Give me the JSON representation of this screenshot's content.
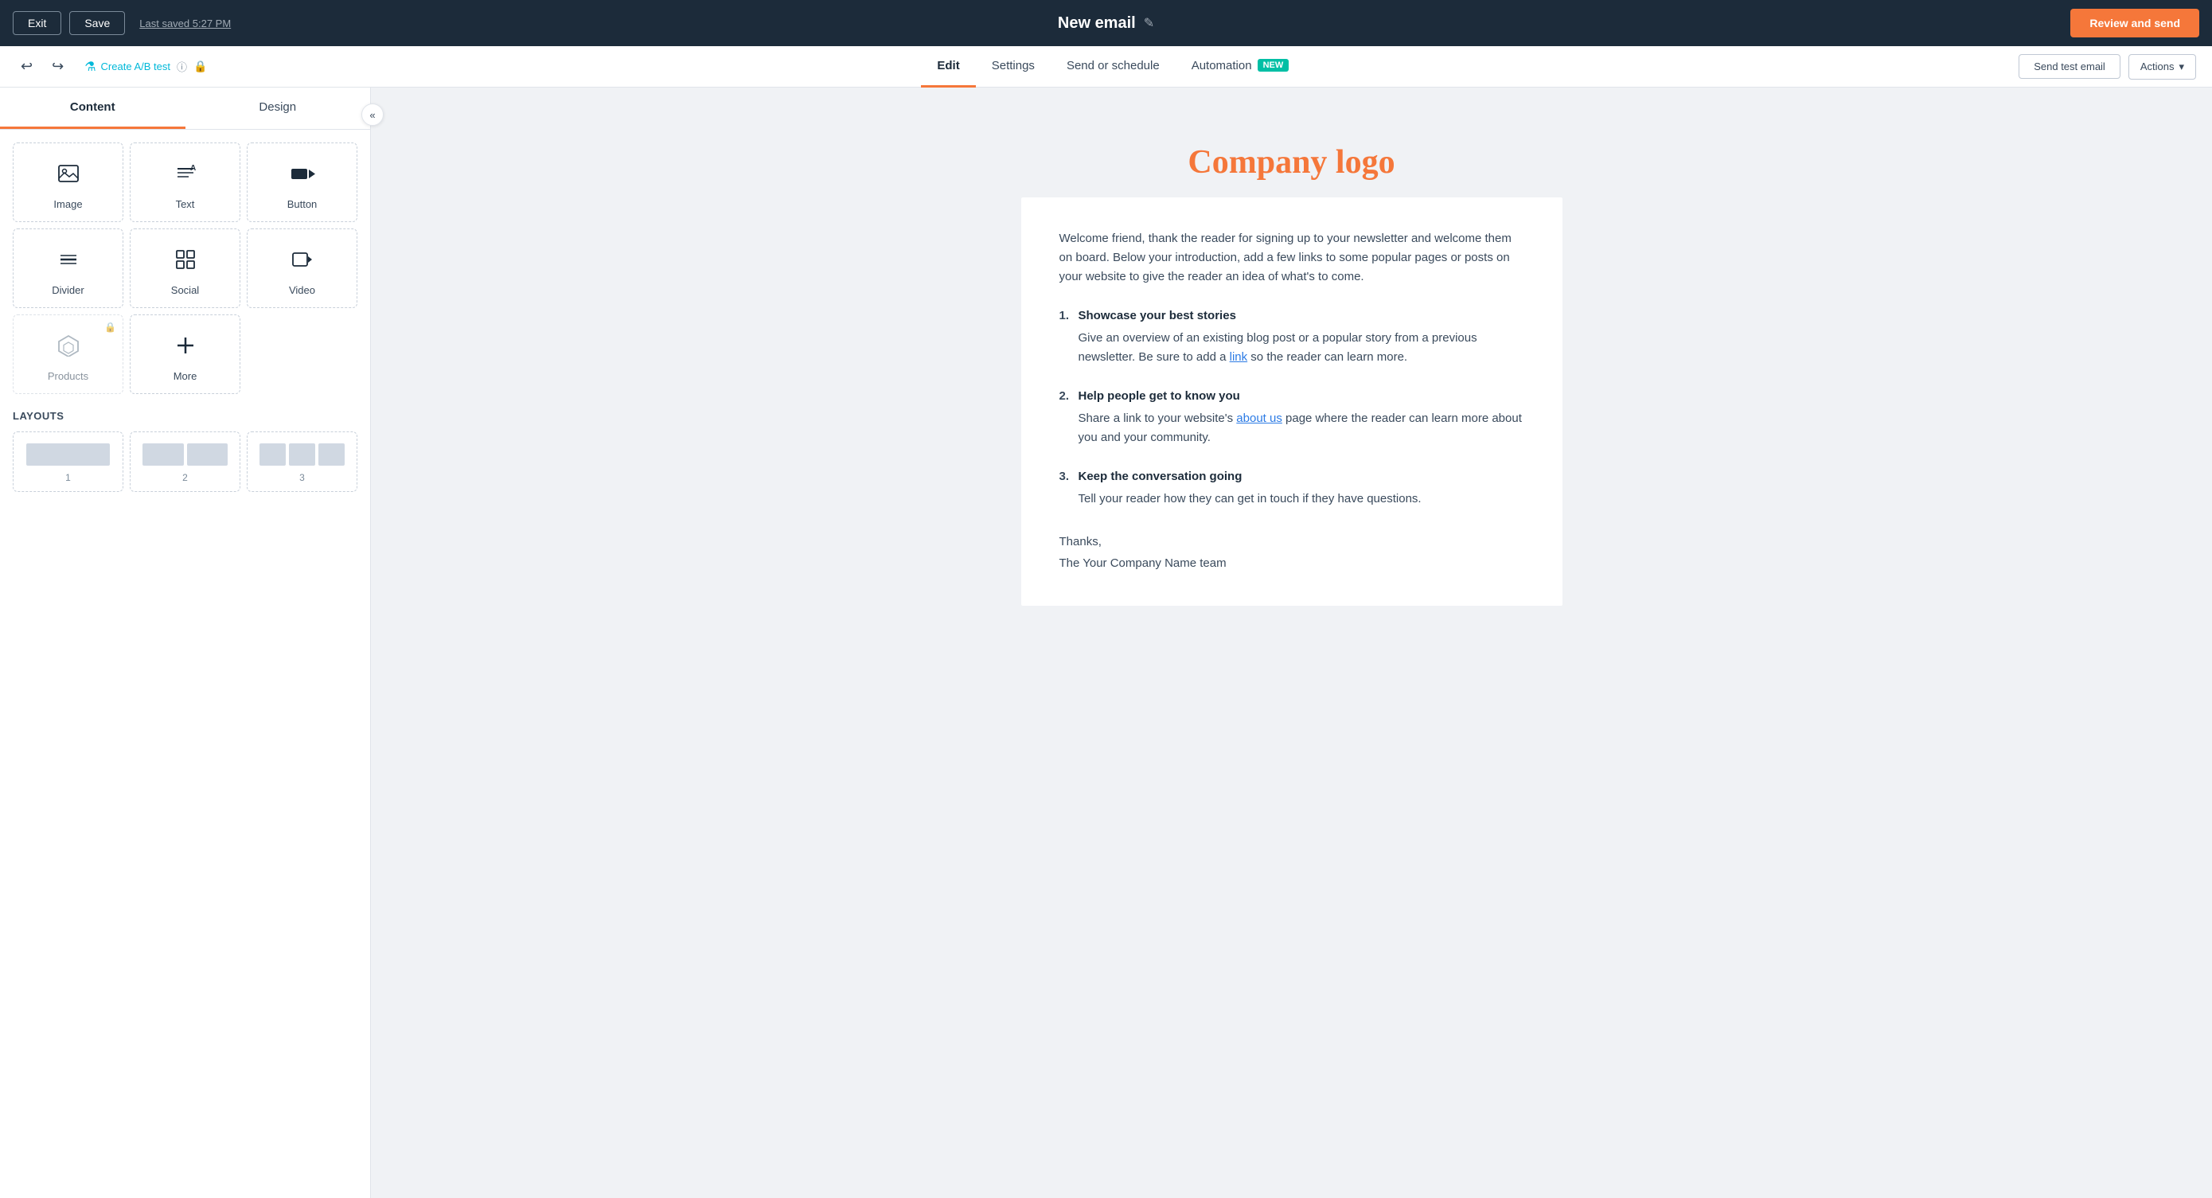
{
  "topbar": {
    "exit_label": "Exit",
    "save_label": "Save",
    "last_saved": "Last saved 5:27 PM",
    "title": "New email",
    "edit_icon": "✎",
    "review_label": "Review and send"
  },
  "subbar": {
    "undo_icon": "↩",
    "redo_icon": "↪",
    "ab_test_label": "Create A/B test",
    "info_icon": "ⓘ",
    "lock_icon": "🔒",
    "tabs": [
      {
        "id": "edit",
        "label": "Edit",
        "active": true,
        "badge": null
      },
      {
        "id": "settings",
        "label": "Settings",
        "active": false,
        "badge": null
      },
      {
        "id": "send-or-schedule",
        "label": "Send or schedule",
        "active": false,
        "badge": null
      },
      {
        "id": "automation",
        "label": "Automation",
        "active": false,
        "badge": "NEW"
      }
    ],
    "send_test_label": "Send test email",
    "actions_label": "Actions",
    "actions_caret": "▾"
  },
  "sidebar": {
    "content_tab": "Content",
    "design_tab": "Design",
    "widgets": [
      {
        "id": "image",
        "label": "Image",
        "icon": "🖼",
        "locked": false
      },
      {
        "id": "text",
        "label": "Text",
        "icon": "≡A",
        "locked": false
      },
      {
        "id": "button",
        "label": "Button",
        "icon": "⬛▶",
        "locked": false
      },
      {
        "id": "divider",
        "label": "Divider",
        "icon": "≡",
        "locked": false
      },
      {
        "id": "social",
        "label": "Social",
        "icon": "#",
        "locked": false
      },
      {
        "id": "video",
        "label": "Video",
        "icon": "▶",
        "locked": false
      },
      {
        "id": "products",
        "label": "Products",
        "icon": "⬡",
        "locked": true
      },
      {
        "id": "more",
        "label": "More",
        "icon": "+",
        "locked": false
      }
    ],
    "layouts_label": "LAYOUTS",
    "layouts": [
      {
        "id": 1,
        "num": "1",
        "cols": [
          100
        ]
      },
      {
        "id": 2,
        "num": "2",
        "cols": [
          48,
          48
        ]
      },
      {
        "id": 3,
        "num": "3",
        "cols": [
          30,
          30,
          30
        ]
      }
    ]
  },
  "email": {
    "logo_text": "Company logo",
    "intro": "Welcome friend, thank the reader for signing up to your newsletter and welcome them on board. Below your introduction, add a few links to some popular pages or posts on your website to give the reader an idea of what's to come.",
    "items": [
      {
        "title": "Showcase your best stories",
        "desc_before": "Give an overview of an existing blog post or a popular story from a previous newsletter. Be sure to add a ",
        "link_text": "link",
        "desc_after": " so the reader can learn more."
      },
      {
        "title": "Help people get to know you",
        "desc_before": "Share a link to your website's ",
        "link_text": "about us",
        "desc_after": " page where the reader can learn more about you and your community."
      },
      {
        "title": "Keep the conversation going",
        "desc_before": "Tell your reader how they can get in touch if they have questions.",
        "link_text": "",
        "desc_after": ""
      }
    ],
    "closing_line1": "Thanks,",
    "closing_line2": "The Your Company Name team"
  }
}
